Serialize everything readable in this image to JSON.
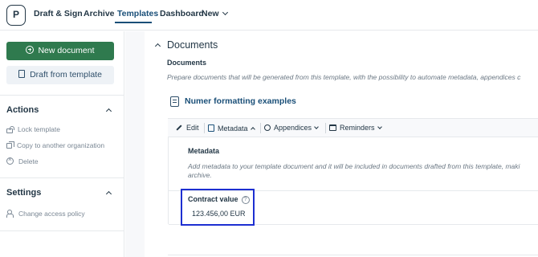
{
  "nav": {
    "logo": "P",
    "links": [
      "Draft & Sign",
      "Archive",
      "Templates",
      "Dashboard",
      "New"
    ],
    "active": "Templates"
  },
  "sidebar": {
    "new_document": "New document",
    "draft_from_template": "Draft from template",
    "actions_title": "Actions",
    "actions": [
      "Lock template",
      "Copy to another organization",
      "Delete"
    ],
    "settings_title": "Settings",
    "settings": [
      "Change access policy"
    ]
  },
  "main": {
    "section_title": "Documents",
    "subheading": "Documents",
    "description": "Prepare documents that will be generated from this template, with the possibility to automate metadata, appendices c",
    "document_name": "Numer formatting examples",
    "toolbar": {
      "edit": "Edit",
      "metadata": "Metadata",
      "appendices": "Appendices",
      "reminders": "Reminders"
    },
    "metadata": {
      "title": "Metadata",
      "desc_line1": "Add metadata to your template document and it will be included in documents drafted from this template, maki",
      "desc_line2": "archive.",
      "field_label": "Contract value",
      "field_value": "123.456,00 EUR",
      "help_glyph": "?"
    }
  },
  "colors": {
    "primary_button": "#2f7a4e",
    "active_nav": "#1a4f78",
    "highlight_box": "#1d2fd1"
  }
}
